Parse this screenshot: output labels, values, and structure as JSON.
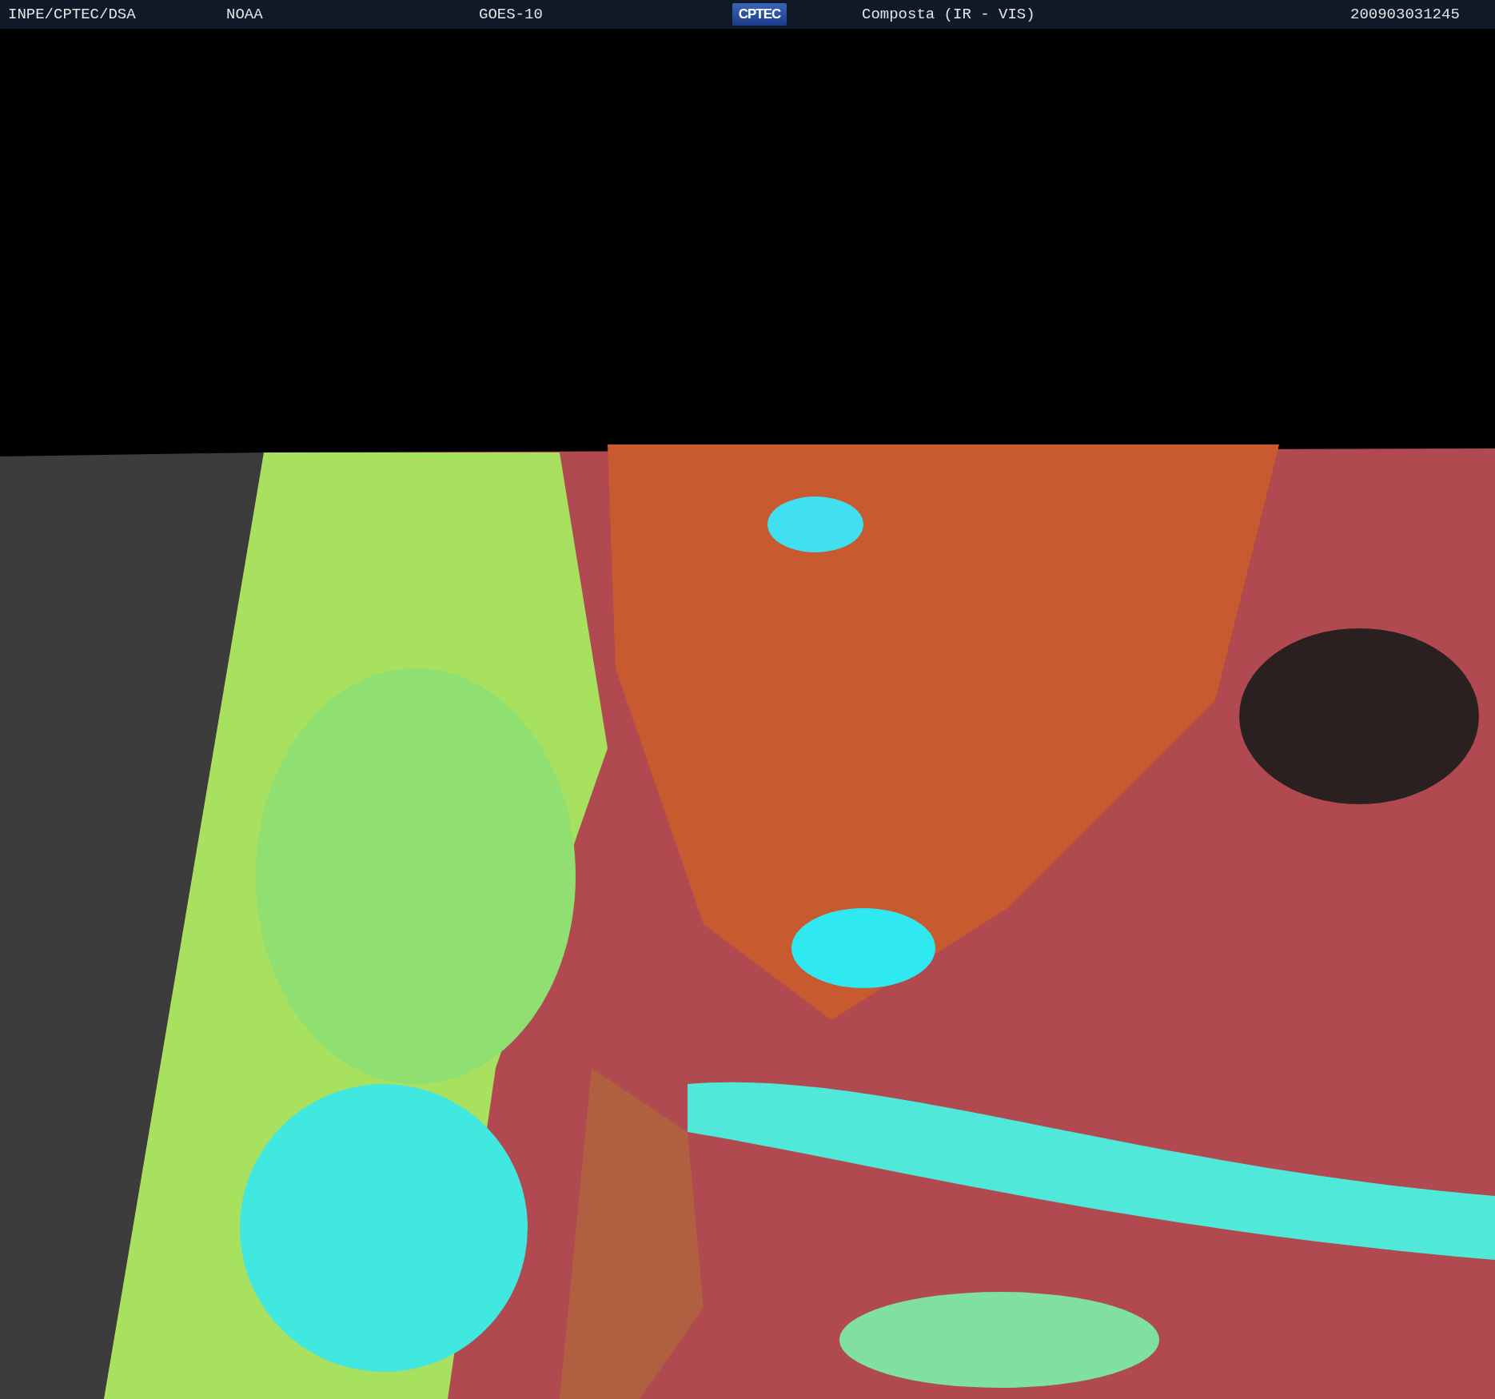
{
  "header": {
    "items": [
      {
        "kind": "text",
        "text": "INPE/CPTEC/DSA"
      },
      {
        "kind": "text",
        "text": "NOAA"
      },
      {
        "kind": "text",
        "text": "GOES-10"
      },
      {
        "kind": "logo",
        "text": "CPTEC"
      },
      {
        "kind": "text",
        "text": "Composta (IR - VIS)"
      },
      {
        "kind": "text",
        "text": "200903031245"
      }
    ]
  }
}
